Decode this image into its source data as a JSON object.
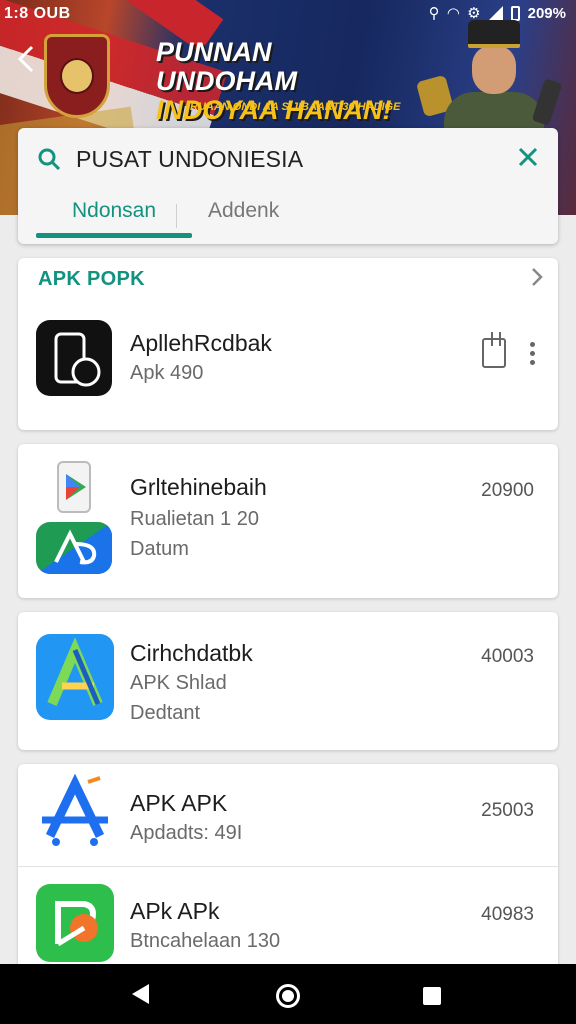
{
  "status_bar": {
    "time": "1:8 OUB",
    "battery": "209%"
  },
  "banner": {
    "headline_line1": "PUNNAN UNDOHAM",
    "headline_line2": "INDOYAA HANAN!",
    "subline": "RUAAN ONDI AA SIJIBAART 30 HADIGE"
  },
  "search": {
    "query": "PUSAT UNDONIESIA",
    "tabs": [
      {
        "label": "Ndonsan",
        "active": true
      },
      {
        "label": "Addenk",
        "active": false
      }
    ]
  },
  "section": {
    "title": "APK POPK"
  },
  "apps": [
    {
      "name": "ApllehRcdbak",
      "line1": "Apk 490",
      "line2": "",
      "count": ""
    },
    {
      "name": "Grltehinebaih",
      "line1": "Rualietan 1 20",
      "line2": "Datum",
      "count": "20900"
    },
    {
      "name": "Cirhchdatbk",
      "line1": "APK Shlad",
      "line2": "Dedtant",
      "count": "40003"
    },
    {
      "name": "APK APK",
      "line1": "Apdadts: 49I",
      "line2": "",
      "count": "25003"
    },
    {
      "name": "APk APk",
      "line1": "Btncahelaan 130",
      "line2": "",
      "count": "40983"
    }
  ],
  "colors": {
    "accent": "#13927f",
    "banner_text": "#f6c21a"
  }
}
